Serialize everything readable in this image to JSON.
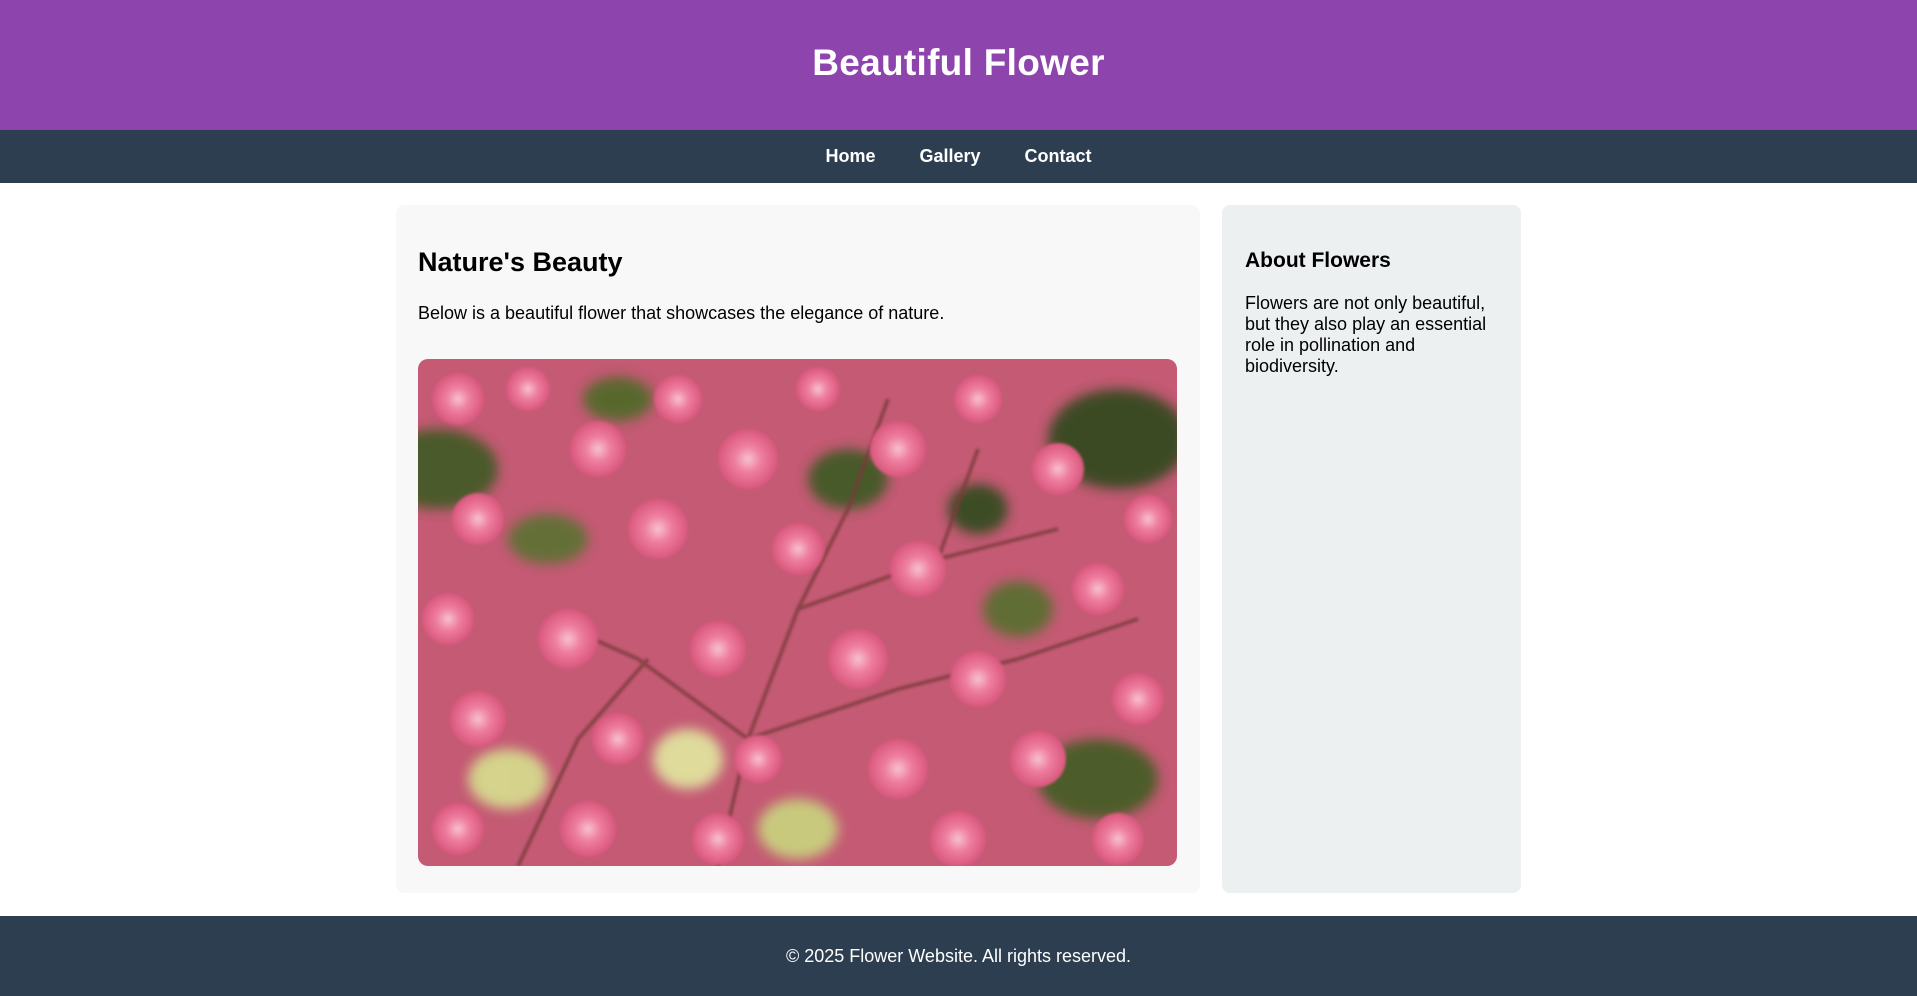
{
  "header": {
    "title": "Beautiful Flower"
  },
  "nav": {
    "items": [
      {
        "label": "Home"
      },
      {
        "label": "Gallery"
      },
      {
        "label": "Contact"
      }
    ]
  },
  "main": {
    "heading": "Nature's Beauty",
    "description": "Below is a beautiful flower that showcases the elegance of nature."
  },
  "sidebar": {
    "heading": "About Flowers",
    "text": "Flowers are not only beautiful, but they also play an essential role in pollination and biodiversity."
  },
  "footer": {
    "text": "© 2025 Flower Website. All rights reserved."
  },
  "colors": {
    "header_bg": "#8e44ad",
    "nav_bg": "#2c3e50",
    "footer_bg": "#2c3e50",
    "main_card_bg": "#f8f8f8",
    "sidebar_bg": "#ecf0f1"
  }
}
